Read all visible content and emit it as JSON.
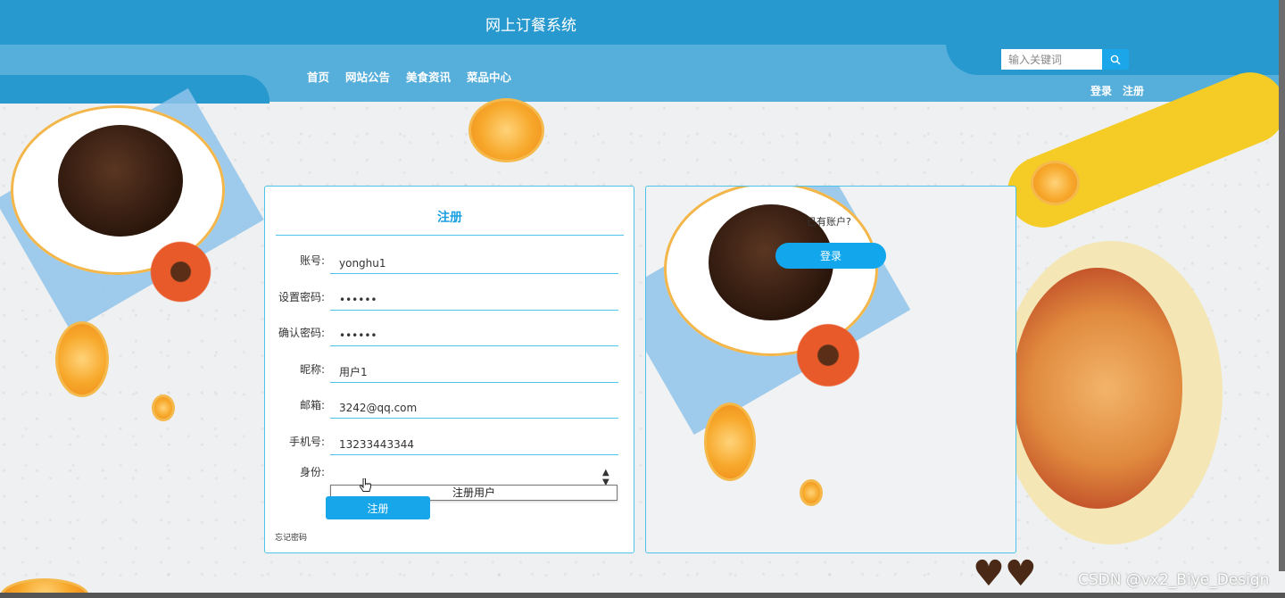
{
  "header": {
    "site_title": "网上订餐系统",
    "nav": [
      "首页",
      "网站公告",
      "美食资讯",
      "菜品中心"
    ],
    "search_placeholder": "输入关键词",
    "login_link": "登录",
    "register_link": "注册"
  },
  "register_form": {
    "title": "注册",
    "fields": [
      {
        "label": "账号:",
        "value": "yonghu1",
        "type": "text"
      },
      {
        "label": "设置密码:",
        "value": "••••••",
        "type": "password"
      },
      {
        "label": "确认密码:",
        "value": "••••••",
        "type": "password"
      },
      {
        "label": "昵称:",
        "value": "用户1",
        "type": "text"
      },
      {
        "label": "邮箱:",
        "value": "3242@qq.com",
        "type": "text"
      },
      {
        "label": "手机号:",
        "value": "13233443344",
        "type": "text"
      }
    ],
    "identity_label": "身份:",
    "identity_value": "",
    "identity_dropdown_option": "注册用户",
    "submit_label": "注册",
    "forgot_password": "忘记密码"
  },
  "login_panel": {
    "prompt": "已有账户?",
    "login_button": "登录"
  },
  "watermark": "CSDN @vx2_Biye_Design"
}
